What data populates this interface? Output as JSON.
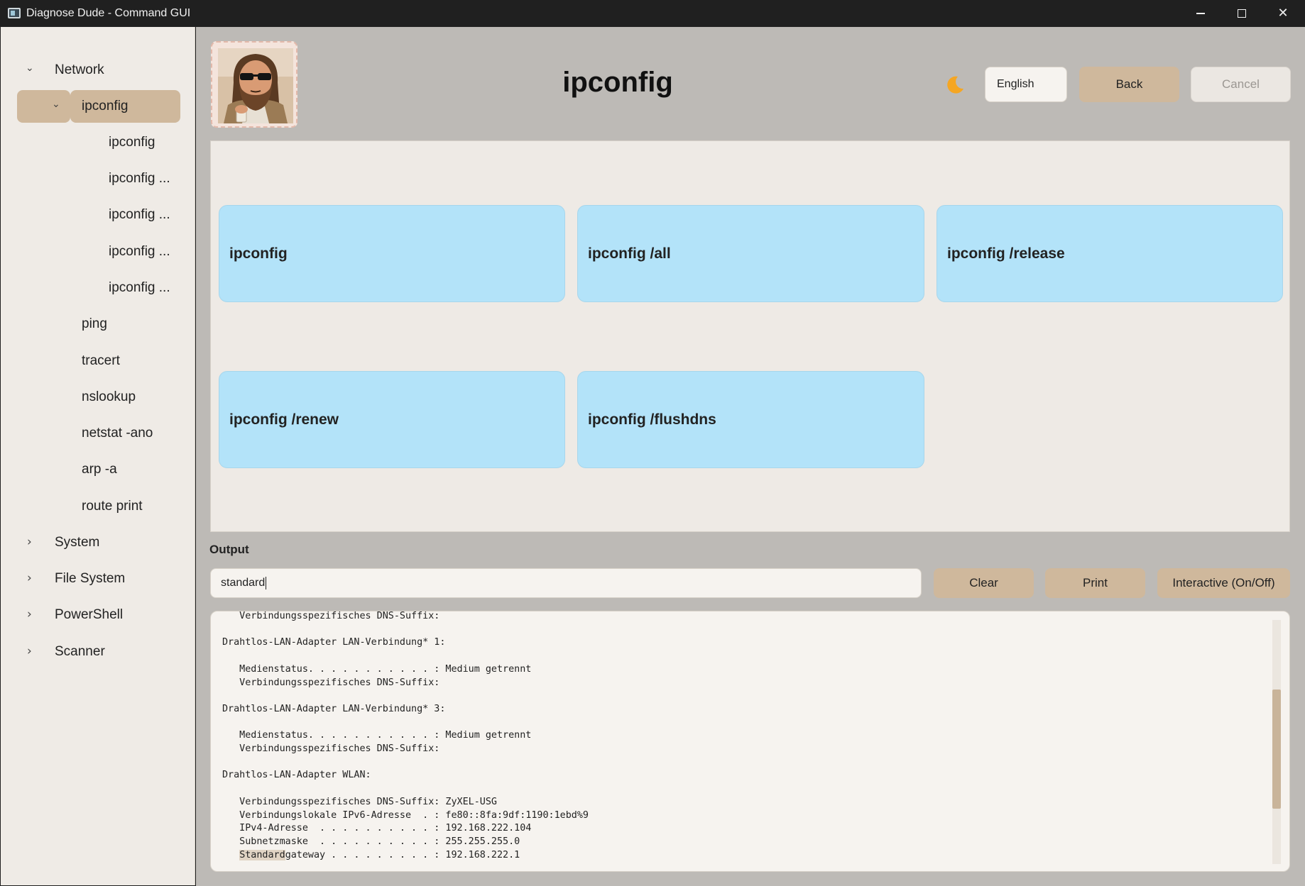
{
  "window": {
    "title": "Diagnose Dude - Command GUI",
    "minimize_glyph": "–",
    "close_glyph": "✕"
  },
  "sidebar": {
    "chevron_open": "⌄",
    "chevron_closed": "›",
    "categories": [
      {
        "label": "Network",
        "expanded": true
      },
      {
        "label": "System",
        "expanded": false
      },
      {
        "label": "File System",
        "expanded": false
      },
      {
        "label": "PowerShell",
        "expanded": false
      },
      {
        "label": "Scanner",
        "expanded": false
      }
    ],
    "network_items": [
      {
        "label": "ipconfig",
        "expanded": true,
        "selected": true
      },
      {
        "label": "ping"
      },
      {
        "label": "tracert"
      },
      {
        "label": "nslookup"
      },
      {
        "label": "netstat -ano"
      },
      {
        "label": "arp -a"
      },
      {
        "label": "route print"
      }
    ],
    "ipconfig_subitems": [
      "ipconfig",
      "ipconfig ...",
      "ipconfig ...",
      "ipconfig ...",
      "ipconfig ..."
    ]
  },
  "header": {
    "avatar": "dude-avatar",
    "title": "ipconfig",
    "theme_icon": "moon-icon",
    "language": "English",
    "back_label": "Back",
    "cancel_label": "Cancel"
  },
  "commands": [
    "ipconfig",
    "ipconfig /all",
    "ipconfig /release",
    "ipconfig /renew",
    "ipconfig /flushdns"
  ],
  "output": {
    "label": "Output",
    "input_value": "standard",
    "clear_label": "Clear",
    "print_label": "Print",
    "interactive_label": "Interactive (On/Off)",
    "lines": [
      "   Verbindungsspezifisches DNS-Suffix:",
      "",
      "Drahtlos-LAN-Adapter LAN-Verbindung* 1:",
      "",
      "   Medienstatus. . . . . . . . . . . : Medium getrennt",
      "   Verbindungsspezifisches DNS-Suffix:",
      "",
      "Drahtlos-LAN-Adapter LAN-Verbindung* 3:",
      "",
      "   Medienstatus. . . . . . . . . . . : Medium getrennt",
      "   Verbindungsspezifisches DNS-Suffix:",
      "",
      "Drahtlos-LAN-Adapter WLAN:",
      "",
      "   Verbindungsspezifisches DNS-Suffix: ZyXEL-USG",
      "   Verbindungslokale IPv6-Adresse  . : fe80::8fa:9df:1190:1ebd%9",
      "   IPv4-Adresse  . . . . . . . . . . : 192.168.222.104",
      "   Subnetzmaske  . . . . . . . . . . : 255.255.255.0"
    ],
    "last_line_highlight": "Standard",
    "last_line_rest": "gateway . . . . . . . . . : 192.168.222.1"
  },
  "colors": {
    "accent_tan": "#cfb89c",
    "card_blue": "#b3e3f9",
    "sidebar_bg": "#efebe6",
    "main_bg": "#bdbab6"
  }
}
